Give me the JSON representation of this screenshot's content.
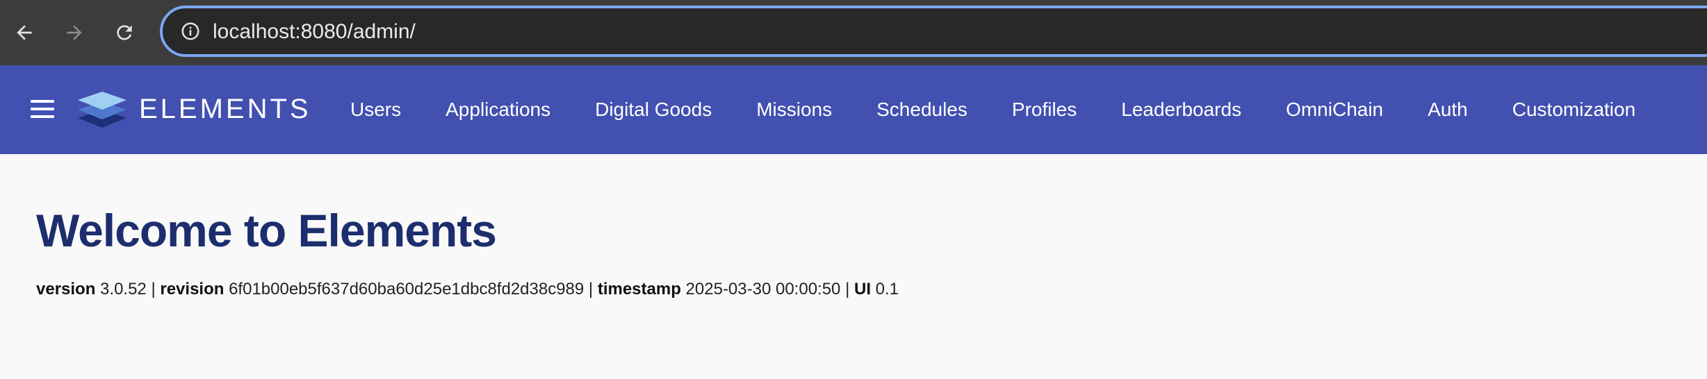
{
  "browser": {
    "url_host": "localhost",
    "url_rest": ":8080/admin/",
    "back_icon": "arrow-left-icon",
    "forward_icon": "arrow-right-icon",
    "reload_icon": "reload-icon",
    "info_icon": "info-circle-icon"
  },
  "header": {
    "brand": "ELEMENTS",
    "menu_icon": "hamburger-menu-icon",
    "logo_icon": "layers-logo-icon",
    "nav": [
      {
        "label": "Users"
      },
      {
        "label": "Applications"
      },
      {
        "label": "Digital Goods"
      },
      {
        "label": "Missions"
      },
      {
        "label": "Schedules"
      },
      {
        "label": "Profiles"
      },
      {
        "label": "Leaderboards"
      },
      {
        "label": "OmniChain"
      },
      {
        "label": "Auth"
      },
      {
        "label": "Customization"
      }
    ]
  },
  "main": {
    "title": "Welcome to Elements",
    "build": {
      "version_label": "version",
      "version": "3.0.52",
      "revision_label": "revision",
      "revision": "6f01b00eb5f637d60ba60d25e1dbc8fd2d38c989",
      "timestamp_label": "timestamp",
      "timestamp": "2025-03-30 00:00:50",
      "ui_label": "UI",
      "ui": "0.1",
      "separator": "|"
    }
  },
  "colors": {
    "header_bg": "#4250b0",
    "title": "#1d2e6e",
    "omnibox_focus": "#7aa7f3",
    "browser_bg": "#3c3c3c",
    "page_bg": "#f9f9f9"
  }
}
